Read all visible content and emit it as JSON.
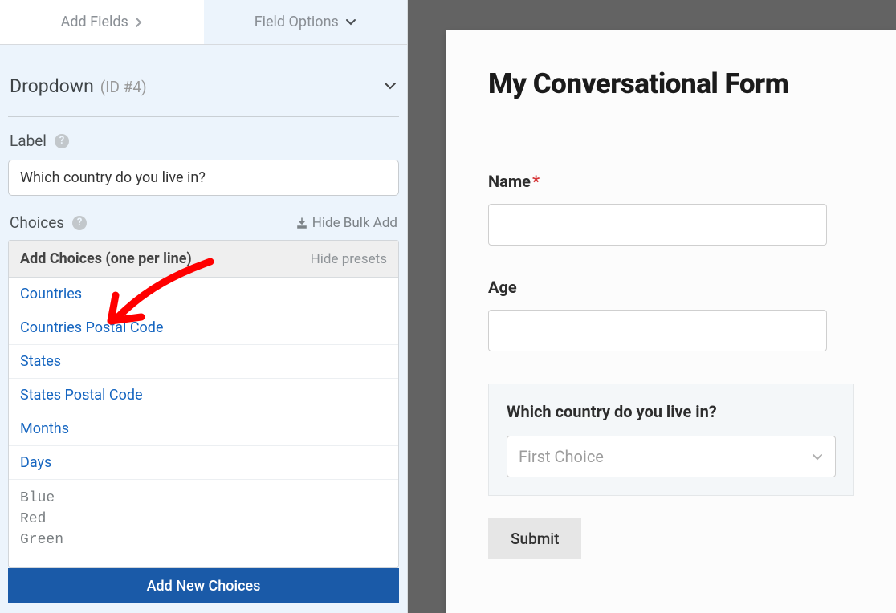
{
  "tabs": {
    "add_fields": "Add Fields",
    "field_options": "Field Options"
  },
  "section": {
    "title": "Dropdown",
    "id": "(ID #4)"
  },
  "label_options": {
    "label_text": "Label",
    "label_value": "Which country do you live in?"
  },
  "choices": {
    "header": "Choices",
    "hide_bulk": "Hide Bulk Add",
    "add_choices_title": "Add Choices (one per line)",
    "hide_presets": "Hide presets",
    "presets": [
      "Countries",
      "Countries Postal Code",
      "States",
      "States Postal Code",
      "Months",
      "Days"
    ],
    "textarea_value": "Blue\nRed\nGreen",
    "add_button": "Add New Choices"
  },
  "preview": {
    "form_title": "My Conversational Form",
    "fields": {
      "name_label": "Name",
      "age_label": "Age",
      "country_label": "Which country do you live in?",
      "country_selected": "First Choice"
    },
    "submit": "Submit"
  }
}
